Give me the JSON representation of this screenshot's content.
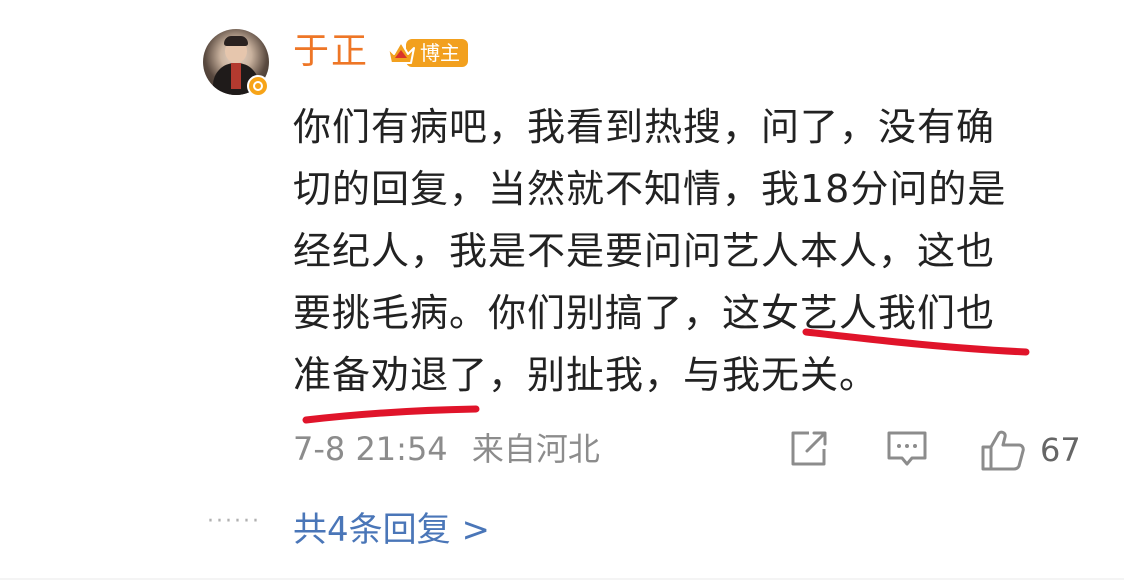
{
  "comment": {
    "username": "于正",
    "badge_label": "博主",
    "body_lines": [
      "你们有病吧，我看到热搜，问了，没有确",
      "切的回复，当然就不知情，我18分问的是",
      "经纪人，我是不是要问问艺人本人，这也",
      "要挑毛病。你们别搞了，这女艺人我们也",
      "准备劝退了，别扯我，与我无关。"
    ],
    "timestamp": "7-8 21:54",
    "location": "来自河北",
    "like_count": "67",
    "replies_link": "共4条回复 >",
    "dots": "······"
  },
  "colors": {
    "username": "#ee7626",
    "badge": "#f2a01e",
    "verify": "#f7a418",
    "link": "#4a76b8",
    "meta": "#8c8c8c",
    "underline": "#e0142a"
  },
  "icons": {
    "share": "share-icon",
    "comment": "comment-icon",
    "like": "thumbs-up-icon",
    "crown": "crown-icon",
    "verify": "verified-badge-icon"
  }
}
